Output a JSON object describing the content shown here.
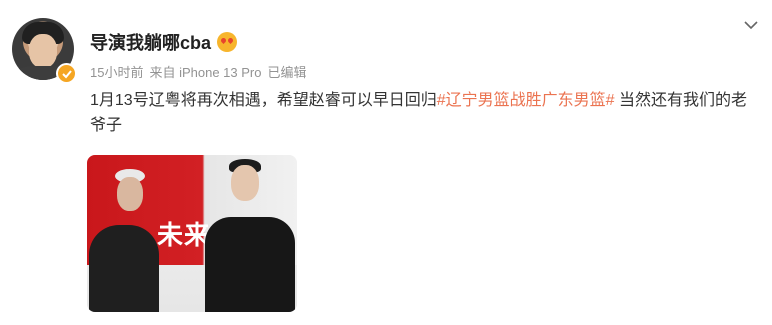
{
  "post": {
    "username": "导演我躺哪cba",
    "username_emoji_icon": "heart-eyes-emoji-icon",
    "time": "15小时前",
    "source": "来自 iPhone 13 Pro",
    "edited": "已编辑",
    "text_before": "1月13号辽粤将再次相遇，希望赵睿可以早日回归",
    "topic": "#辽宁男篮战胜广东男篮#",
    "text_after": " 当然还有我们的老爷子",
    "banner_text": "未来"
  },
  "colors": {
    "topic": "#eb7350",
    "verify_badge": "#f5a623"
  }
}
